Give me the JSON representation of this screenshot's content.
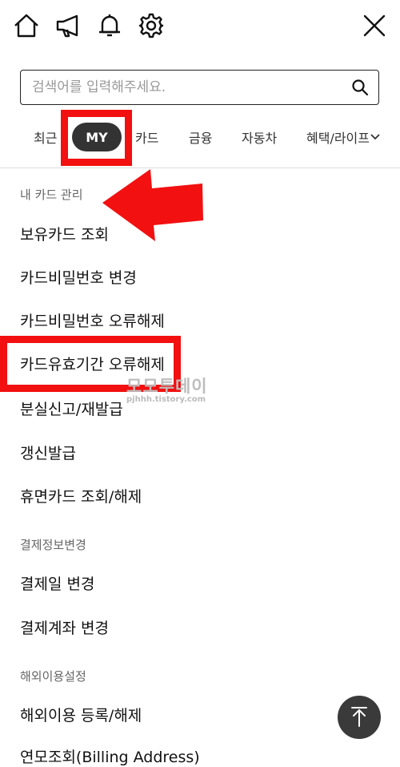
{
  "header": {
    "icons": [
      "home-icon",
      "megaphone-icon",
      "bell-icon",
      "gear-icon",
      "close-icon"
    ]
  },
  "search": {
    "placeholder": "검색어를 입력해주세요.",
    "icon": "search-icon"
  },
  "tabs": [
    {
      "label": "최근"
    },
    {
      "label": "MY",
      "active": true
    },
    {
      "label": "카드"
    },
    {
      "label": "금융"
    },
    {
      "label": "자동차"
    },
    {
      "label": "혜택/라이프"
    }
  ],
  "menu": {
    "section1": {
      "title": "내 카드 관리",
      "items": [
        "보유카드 조회",
        "카드비밀번호 변경",
        "카드비밀번호 오류해제",
        "카드유효기간 오류해제",
        "분실신고/재발급",
        "갱신발급",
        "휴면카드 조회/해제"
      ]
    },
    "section2": {
      "title": "결제정보변경",
      "items": [
        "결제일 변경",
        "결제계좌 변경"
      ]
    },
    "section3": {
      "title": "해외이용설정",
      "items": [
        "해외이용 등록/해제",
        "연모조회(Billing Address)"
      ]
    }
  },
  "watermark": {
    "title": "모모투데이",
    "subtitle": "pjhhh.tistory.com"
  },
  "colors": {
    "highlight": "#f21010",
    "active_tab_bg": "#333333",
    "fab_bg": "#3a3a3a"
  }
}
